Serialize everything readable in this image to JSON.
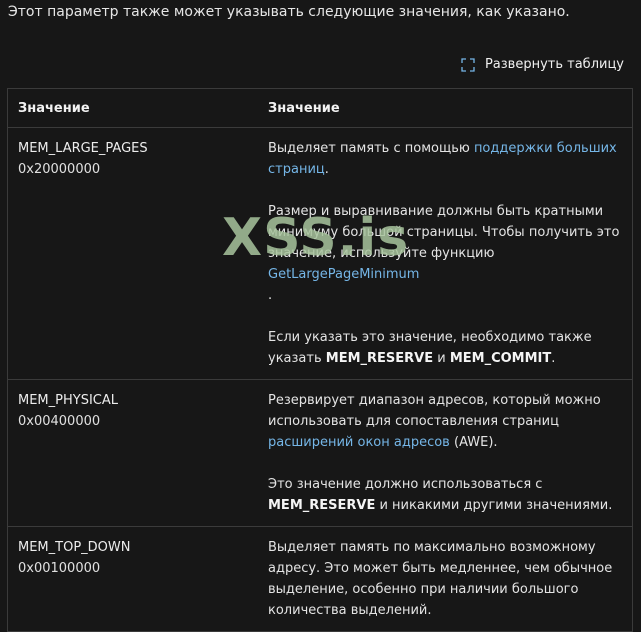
{
  "intro_text": "Этот параметр также может указывать следующие значения, как указано.",
  "expand_label": "Развернуть таблицу",
  "table": {
    "headers": [
      "Значение",
      "Значение"
    ],
    "rows": [
      {
        "name": "MEM_LARGE_PAGES",
        "value": "0x20000000",
        "p1_text": "Выделяет память с помощью ",
        "p1_link": "поддержки больших страниц",
        "p1_end": ".",
        "p2_text": "Размер и выравнивание должны быть кратными минимуму большой страницы. Чтобы получить это значение, используйте функцию ",
        "p2_link": "GetLargePageMinimum",
        "p2_end": ".",
        "p3_text": "Если указать это значение, необходимо также указать ",
        "p3_b1": "MEM_RESERVE",
        "p3_mid": " и ",
        "p3_b2": "MEM_COMMIT",
        "p3_end": "."
      },
      {
        "name": "MEM_PHYSICAL",
        "value": "0x00400000",
        "p1_text": "Резервирует диапазон адресов, который можно использовать для сопоставления страниц ",
        "p1_link": "расширений окон адресов",
        "p1_end": " (AWE).",
        "p2_text": "Это значение должно использоваться с ",
        "p2_b": "MEM_RESERVE",
        "p2_end": " и никакими другими значениями."
      },
      {
        "name": "MEM_TOP_DOWN",
        "value": "0x00100000",
        "p1_text": "Выделяет память по максимально возможному адресу. Это может быть медленнее, чем обычное выделение, особенно при наличии большого количества выделений."
      }
    ]
  },
  "watermark": "XSS.is",
  "colors": {
    "background": "#171717",
    "link": "#75b6e7",
    "border": "#3b3b3b"
  }
}
